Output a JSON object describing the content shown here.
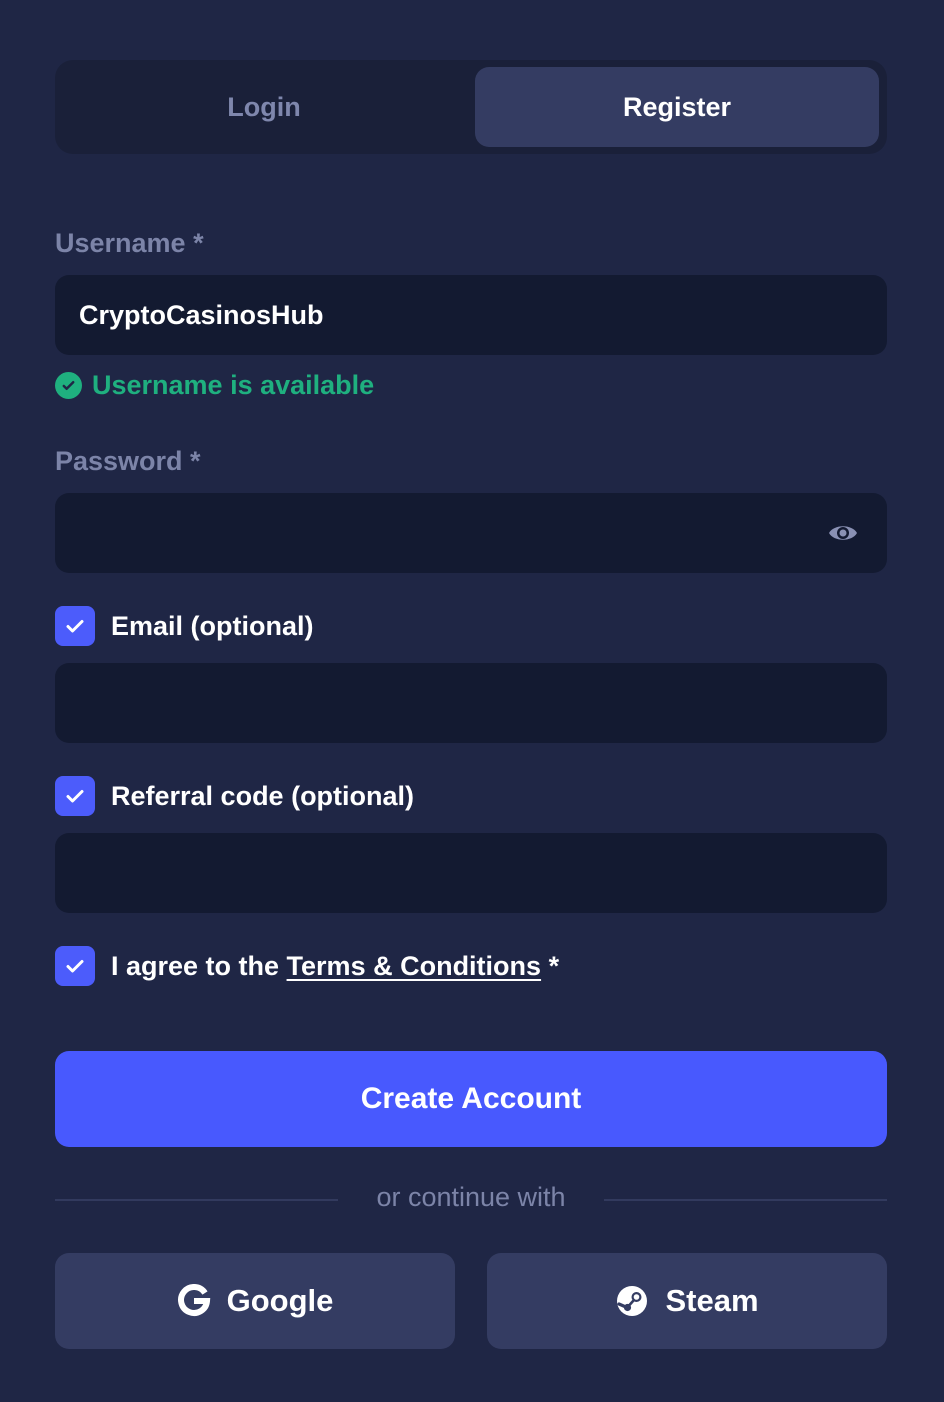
{
  "tabs": {
    "login": "Login",
    "register": "Register",
    "active": "register"
  },
  "username": {
    "label": "Username *",
    "value": "CryptoCasinosHub",
    "status": "Username is available"
  },
  "password": {
    "label": "Password *",
    "value": ""
  },
  "email": {
    "label": "Email (optional)",
    "checked": true,
    "value": ""
  },
  "referral": {
    "label": "Referral code (optional)",
    "checked": true,
    "value": ""
  },
  "terms": {
    "prefix": "I agree to the ",
    "link": "Terms & Conditions",
    "suffix": " *",
    "checked": true
  },
  "create_button": "Create Account",
  "divider": "or continue with",
  "social": {
    "google": "Google",
    "steam": "Steam"
  },
  "colors": {
    "background": "#1f2645",
    "accent": "#4859fe",
    "success": "#1fb07f",
    "input_bg": "#131a31"
  },
  "icons": [
    "check-circle-icon",
    "eye-icon",
    "checkmark-icon",
    "google-icon",
    "steam-icon"
  ]
}
